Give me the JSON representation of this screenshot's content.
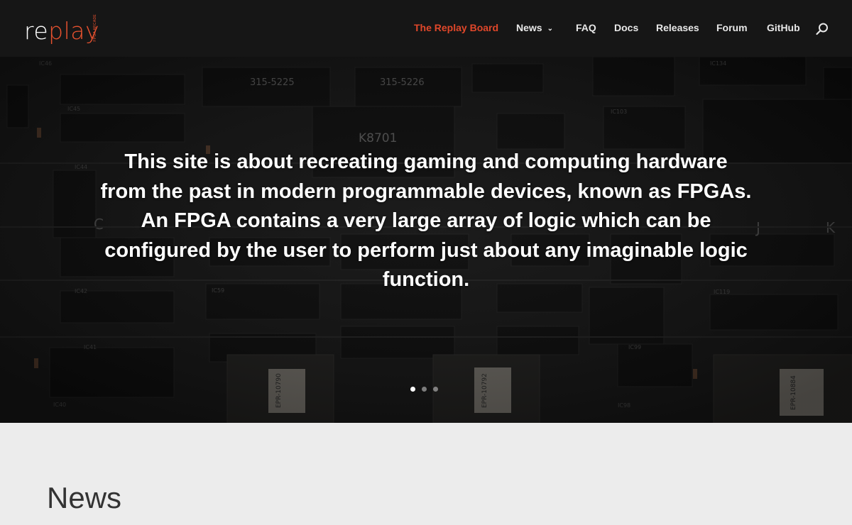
{
  "brand": {
    "logo_prefix": "re",
    "logo_suffix": "play",
    "logo_tagline": "FPGA ARCADE",
    "accent_color": "#e0472a"
  },
  "nav": {
    "items": [
      {
        "label": "The Replay Board",
        "active": true
      },
      {
        "label": "News",
        "has_dropdown": true
      },
      {
        "label": "FAQ"
      },
      {
        "label": "Docs"
      },
      {
        "label": "Releases"
      },
      {
        "label": "Forum"
      },
      {
        "label": "GitHub"
      }
    ],
    "search_icon": "search-icon",
    "dropdown_icon": "chevron-down-icon"
  },
  "hero": {
    "text": "This site is about recreating gaming and computing hardware from the past in modern programmable devices, known as FPGAs. An FPGA contains a very large array of logic which can be configured by the user to perform just about any imaginable logic function.",
    "background_image": "circuit-board-photo",
    "chip_labels": [
      "315-5225",
      "315-5226",
      "K8701",
      "EPR-10790",
      "EPR-10792",
      "EPR-10884"
    ],
    "slides_total": 3,
    "active_slide": 1
  },
  "section": {
    "title": "News"
  }
}
